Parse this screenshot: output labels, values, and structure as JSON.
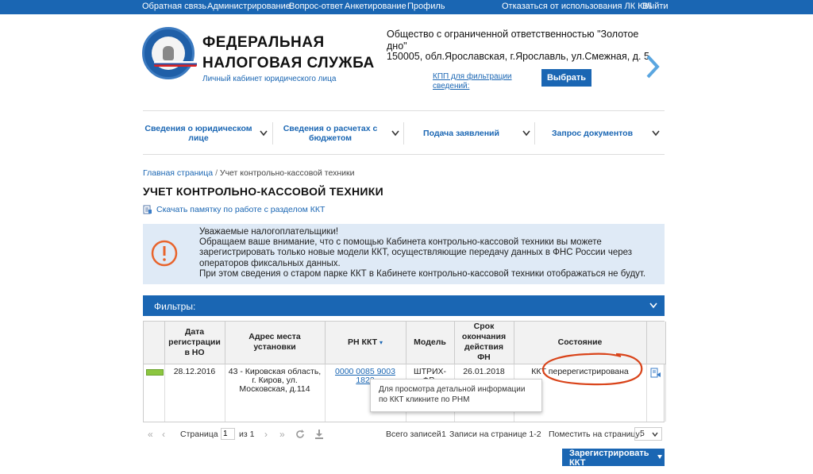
{
  "topbar": {
    "feedback": "Обратная связь",
    "admin": "Администрирование",
    "qa": "Вопрос-ответ",
    "survey": "Анкетирование",
    "profile": "Профиль",
    "opt_out": "Отказаться от использования ЛК ЮЛ",
    "logout": "Выйти"
  },
  "brand": {
    "title_line1": "ФЕДЕРАЛЬНАЯ",
    "title_line2": "НАЛОГОВАЯ СЛУЖБА",
    "subtitle": "Личный кабинет юридического лица",
    "logo_icon": "fns-emblem-icon"
  },
  "org": {
    "name": "Общество с ограниченной ответственностью \"Золотое дно\"",
    "address": "150005, обл.Ярославская, г.Ярославль, ул.Смежная, д. 5",
    "kpp_filter_link": "КПП для фильтрации сведений:",
    "select_button": "Выбрать"
  },
  "nav": {
    "items": [
      {
        "label": "Сведения о юридическом лице"
      },
      {
        "label": "Сведения о расчетах с бюджетом"
      },
      {
        "label": "Подача заявлений"
      },
      {
        "label": "Запрос документов"
      }
    ]
  },
  "breadcrumb": {
    "home": "Главная страница",
    "separator": "/",
    "current": "Учет контрольно-кассовой техники"
  },
  "page": {
    "title": "УЧЕТ КОНТРОЛЬНО-КАССОВОЙ ТЕХНИКИ",
    "memo_link": "Скачать памятку по работе с разделом ККТ"
  },
  "notice": {
    "lines": [
      "Уважаемые налогоплательщики!",
      "Обращаем ваше внимание, что с помощью Кабинета контрольно-кассовой техники вы можете",
      "зарегистрировать только новые модели ККТ, осуществляющие передачу данных в ФНС России через",
      "операторов фиксальных данных.",
      "При этом сведения о старом парке ККТ в Кабинете контрольно-кассовой техники отображаться не будут."
    ]
  },
  "filters": {
    "label": "Фильтры:"
  },
  "table": {
    "headers": {
      "reg_date": "Дата регистрации в НО",
      "address": "Адрес места установки",
      "rn_kkt": "РН ККТ",
      "sort_arrow": "▾",
      "model": "Модель",
      "fn_expiry": "Срок окончания действия ФН",
      "state": "Состояние"
    },
    "rows": [
      {
        "reg_date": "28.12.2016",
        "address": "43 - Кировская область, г. Киров, ул. Московская, д.114",
        "rn_kkt": "0000 0085 9003 1823",
        "model": "ШТРИХ-ФР-",
        "fn_expiry": "26.01.2018",
        "state": "ККТ перерегистрирована"
      }
    ]
  },
  "tooltip": {
    "text": "Для просмотра детальной информации по ККТ кликните по РНМ"
  },
  "pager": {
    "page_label": "Страница",
    "page_value": "1",
    "of_label": "из 1",
    "total_records_label": "Всего записей",
    "total_records": "1",
    "records_on_page_label": "Записи на странице 1-2",
    "page_size_label": "Поместить на страницу:",
    "page_size": "5"
  },
  "actions": {
    "register_button": "Зарегистрировать ККТ"
  },
  "colors": {
    "brand_blue": "#1a66b3",
    "notice_bg": "#dfeaf6",
    "warning_orange": "#e8642c",
    "status_green": "#8cc63f",
    "highlight_red": "#d9441a"
  }
}
